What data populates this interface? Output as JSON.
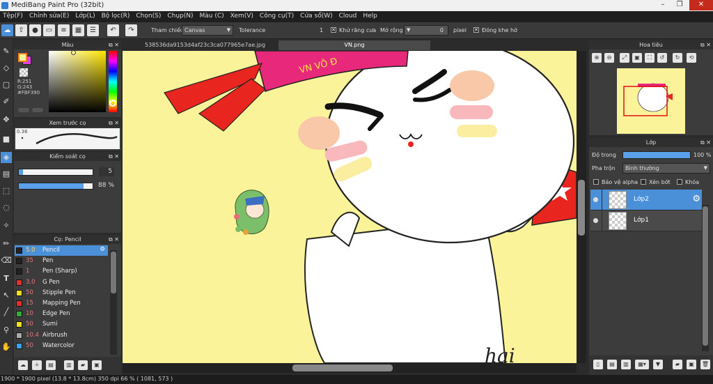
{
  "app": {
    "title": "MediBang Paint Pro (32bit)",
    "window_buttons": [
      "–",
      "❐",
      "✕"
    ]
  },
  "menu": [
    "Tệp(F)",
    "Chỉnh sửa(E)",
    "Lớp(L)",
    "Bộ lọc(R)",
    "Chọn(S)",
    "Chụp(N)",
    "Màu (C)",
    "Xem(V)",
    "Công cụ(T)",
    "Cửa sổ(W)",
    "Cloud",
    "Help"
  ],
  "toolbar": {
    "reference_label": "Tham chiếu",
    "reference_value": "Canvas",
    "tolerance_label": "Tolerance",
    "tolerance_value": "1",
    "antialias_label": "Khử răng cưa",
    "expand_label": "Mở rộng",
    "expand_value": "0",
    "expand_unit": "pixel",
    "close_gap_label": "Đóng khe hở"
  },
  "color_panel": {
    "title": "Màu",
    "r": "R:251",
    "g": "G:243",
    "hex": "#FBF390",
    "primary_color": "#fbf399",
    "secondary_color": "#e040e0"
  },
  "brush_preview": {
    "title": "Xem trước cọ",
    "size_label": "0.36"
  },
  "brush_control": {
    "title": "Kiểm soát cọ",
    "size_value": "5",
    "size_fraction": 0.06,
    "opacity_value": "88 %",
    "opacity_fraction": 0.88
  },
  "brush_list": {
    "title": "Cọ: Pencil",
    "items": [
      {
        "size": "5.0",
        "name": "Pencil",
        "color": "#222222",
        "selected": true
      },
      {
        "size": "35",
        "name": "Pen",
        "color": "#222222",
        "selected": false
      },
      {
        "size": "1",
        "name": "Pen (Sharp)",
        "color": "#222222",
        "selected": false
      },
      {
        "size": "3.0",
        "name": "G Pen",
        "color": "#e03030",
        "selected": false
      },
      {
        "size": "50",
        "name": "Stipple Pen",
        "color": "#f0e020",
        "selected": false
      },
      {
        "size": "15",
        "name": "Mapping Pen",
        "color": "#e03030",
        "selected": false
      },
      {
        "size": "10",
        "name": "Edge Pen",
        "color": "#30b030",
        "selected": false
      },
      {
        "size": "50",
        "name": "Sumi",
        "color": "#f0e020",
        "selected": false
      },
      {
        "size": "10.4",
        "name": "Airbrush",
        "color": "#aaaaaa",
        "selected": false
      },
      {
        "size": "50",
        "name": "Watercolor",
        "color": "#40a0f0",
        "selected": false
      }
    ]
  },
  "tabs": [
    "538536da9153d4af23c3ca077965e7ae.jpg",
    "VN.png"
  ],
  "canvas": {
    "headband_text": "VN VÔ Đ",
    "signature": "hai"
  },
  "navigator": {
    "title": "Hoa tiêu"
  },
  "layers": {
    "title": "Lớp",
    "opacity_label": "Độ trong",
    "opacity_value": "100 %",
    "opacity_fraction": 1.0,
    "blend_label": "Pha trộn",
    "blend_value": "Bình thường",
    "protect_alpha": "Bảo vệ alpha",
    "clipping": "Xén bớt",
    "lock": "Khóa",
    "items": [
      {
        "name": "Lớp2",
        "selected": true
      },
      {
        "name": "Lớp1",
        "selected": false
      }
    ]
  },
  "status": {
    "text": "1900 * 1900 pixel   (13.8 * 13.8cm)   350 dpi   66 %   ( 1081, 573 )"
  }
}
